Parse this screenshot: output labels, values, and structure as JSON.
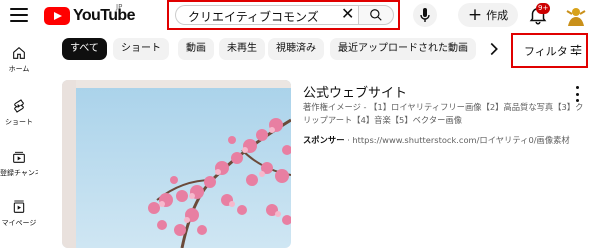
{
  "header": {
    "logo_text": "YouTube",
    "region": "JP",
    "search": {
      "query": "クリエイティブコモンズ"
    },
    "create_label": "作成",
    "notification_count": "9+"
  },
  "sidebar": {
    "items": [
      {
        "label": "ホーム",
        "icon": "home-icon"
      },
      {
        "label": "ショート",
        "icon": "shorts-icon"
      },
      {
        "label": "登録チャンネル",
        "icon": "subscriptions-icon"
      },
      {
        "label": "マイページ",
        "icon": "library-icon"
      }
    ]
  },
  "chips": {
    "items": [
      "すべて",
      "ショート",
      "動画",
      "未再生",
      "視聴済み",
      "最近アップロードされた動画"
    ],
    "active_index": 0,
    "filter_label": "フィルタ"
  },
  "result": {
    "title": "公式ウェブサイト",
    "description": "著作権イメージ - 【1】ロイヤリティフリー画像【2】高品質な写真【3】クリップアート【4】音楽【5】ベクター画像",
    "sponsor_label": "スポンサー",
    "sponsor_url": "· https://www.shutterstock.com/ロイヤリティ0/画像素材"
  },
  "colors": {
    "accent": "#ff0000",
    "highlight_box": "#e00000",
    "chip_active": "#0f0f0f"
  }
}
